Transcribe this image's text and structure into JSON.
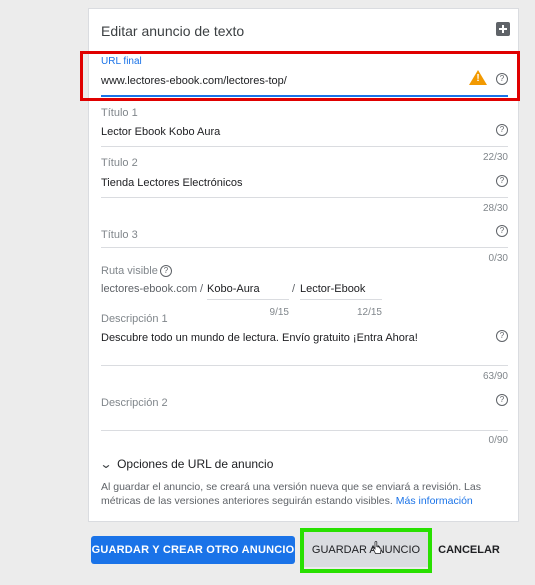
{
  "header": {
    "title": "Editar anuncio de texto"
  },
  "final_url": {
    "label": "URL final",
    "value": "www.lectores-ebook.com/lectores-top/",
    "warning_icon": "warning-icon",
    "help_icon": "help-icon"
  },
  "headline1": {
    "label": "Título 1",
    "value": "Lector Ebook Kobo Aura",
    "counter": "22/30"
  },
  "headline2": {
    "label": "Título 2",
    "value": "Tienda Lectores Electrónicos",
    "counter": "28/30"
  },
  "headline3": {
    "label": "Título 3",
    "value": "",
    "counter": "0/30"
  },
  "path": {
    "label": "Ruta visible",
    "domain": "lectores-ebook.com /",
    "path1": "Kobo-Aura",
    "sep": "/",
    "path2": "Lector-Ebook",
    "counter1": "9/15",
    "counter2": "12/15"
  },
  "description1": {
    "label": "Descripción 1",
    "value": "Descubre todo un mundo de lectura. Envío gratuito ¡Entra Ahora!",
    "counter": "63/90"
  },
  "description2": {
    "label": "Descripción 2",
    "value": "",
    "counter": "0/90"
  },
  "url_options": {
    "label": "Opciones de URL de anuncio"
  },
  "notice": {
    "text": "Al guardar el anuncio, se creará una versión nueva que se enviará a revisión. Las métricas de las versiones anteriores seguirán estando visibles.",
    "link": "Más información"
  },
  "buttons": {
    "save_create": "GUARDAR Y CREAR OTRO ANUNCIO",
    "save": "GUARDAR ANUNCIO",
    "cancel": "CANCELAR"
  },
  "colors": {
    "accent": "#1a73e8",
    "warning": "#f29900",
    "highlight_red": "#e00000",
    "highlight_green": "#28e000"
  }
}
